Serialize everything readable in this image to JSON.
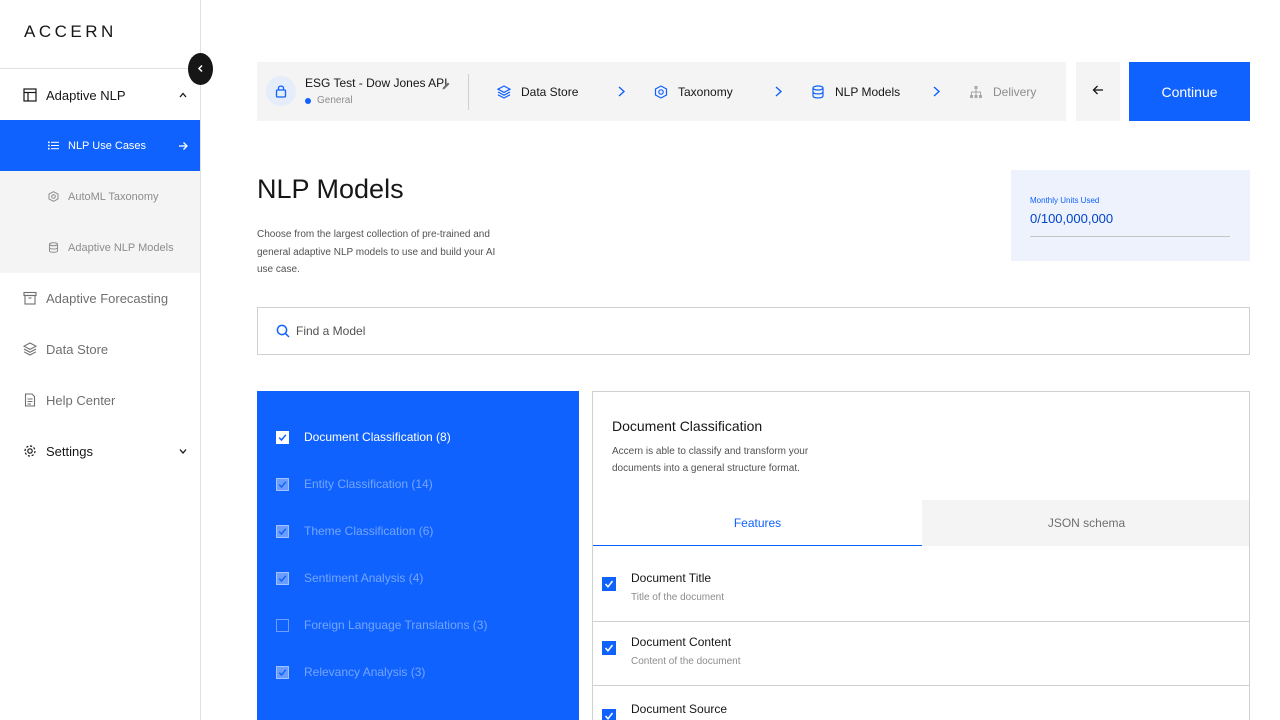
{
  "brand": {
    "logo": "ACCERN",
    "accent": "#0f62fe"
  },
  "sidebar": {
    "collapse_icon": "chevron-left-icon",
    "items": [
      {
        "label": "Adaptive NLP",
        "icon": "layout-icon",
        "expanded": true
      },
      {
        "label": "Adaptive Forecasting",
        "icon": "archive-icon"
      },
      {
        "label": "Data Store",
        "icon": "layers-icon"
      },
      {
        "label": "Help Center",
        "icon": "document-icon"
      },
      {
        "label": "Settings",
        "icon": "gear-icon"
      }
    ],
    "subitems": [
      {
        "label": "NLP Use Cases",
        "icon": "list-icon",
        "active": true
      },
      {
        "label": "AutoML Taxonomy",
        "icon": "hexagon-icon"
      },
      {
        "label": "Adaptive NLP Models",
        "icon": "database-icon"
      }
    ]
  },
  "progress": {
    "project_name": "ESG Test - Dow Jones API",
    "project_tag": "General",
    "steps": [
      {
        "label": "Data Store",
        "icon": "layers-icon"
      },
      {
        "label": "Taxonomy",
        "icon": "hexagon-icon"
      },
      {
        "label": "NLP Models",
        "icon": "database-icon"
      },
      {
        "label": "Delivery",
        "icon": "hierarchy-icon"
      }
    ],
    "back_icon": "arrow-left-icon",
    "continue_label": "Continue"
  },
  "header": {
    "title": "NLP Models",
    "description": "Choose from the largest collection of pre-trained and general adaptive NLP models to use and build your AI use case."
  },
  "units": {
    "label": "Monthly Units Used",
    "value": "0/100,000,000"
  },
  "search": {
    "placeholder": "Find a Model",
    "value": ""
  },
  "models": [
    {
      "label": "Document Classification (8)",
      "checked": true,
      "active": true
    },
    {
      "label": "Entity Classification (14)",
      "checked": true,
      "active": false
    },
    {
      "label": "Theme Classification (6)",
      "checked": true,
      "active": false
    },
    {
      "label": "Sentiment Analysis (4)",
      "checked": true,
      "active": false
    },
    {
      "label": "Foreign Language Translations (3)",
      "checked": false,
      "active": false
    },
    {
      "label": "Relevancy Analysis (3)",
      "checked": true,
      "active": false
    }
  ],
  "detail": {
    "title": "Document Classification",
    "description": "Accern is able to classify and transform your documents into a general structure format.",
    "tabs": [
      {
        "label": "Features",
        "active": true
      },
      {
        "label": "JSON schema",
        "active": false
      }
    ],
    "features": [
      {
        "name": "Document Title",
        "desc": "Title of the document",
        "checked": true
      },
      {
        "name": "Document Content",
        "desc": "Content of the document",
        "checked": true
      },
      {
        "name": "Document Source",
        "desc": "",
        "checked": true
      }
    ]
  }
}
